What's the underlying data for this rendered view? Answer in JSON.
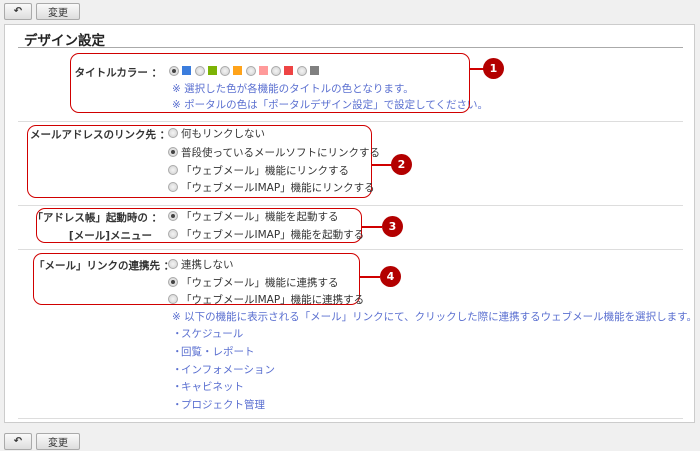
{
  "toolbar": {
    "back_icon": "back-arrow-icon",
    "change_label": "変更"
  },
  "page_title": "デザイン設定",
  "title_color": {
    "label": "タイトルカラー ：",
    "swatches": [
      "#3b7ddd",
      "#7cb305",
      "#ffa31a",
      "#ff9a9a",
      "#ee4444",
      "#808080"
    ],
    "selected": 0,
    "notes": [
      "※ 選択した色が各機能のタイトルの色となります。",
      "※ ポータルの色は「ポータルデザイン設定」で設定してください。"
    ]
  },
  "mail_link": {
    "label": "メールアドレスのリンク先 ：",
    "options": [
      "何もリンクしない",
      "普段使っているメールソフトにリンクする",
      "「ウェブメール」機能にリンクする",
      "「ウェブメールIMAP」機能にリンクする"
    ],
    "selected": 1
  },
  "address_book": {
    "label_line1": "「アドレス帳」起動時の ：",
    "label_line2": "[メール]メニュー",
    "options": [
      "「ウェブメール」機能を起動する",
      "「ウェブメールIMAP」機能を起動する"
    ],
    "selected": 0
  },
  "mail_link_target": {
    "label": "「メール」リンクの連携先 ：",
    "options": [
      "連携しない",
      "「ウェブメール」機能に連携する",
      "「ウェブメールIMAP」機能に連携する"
    ],
    "selected": 1,
    "note": "※ 以下の機能に表示される「メール」リンクにて、クリックした際に連携するウェブメール機能を選択します。",
    "features": [
      "スケジュール",
      "回覧・レポート",
      "インフォメーション",
      "キャビネット",
      "プロジェクト管理"
    ],
    "bullet": "・"
  },
  "markers": [
    "1",
    "2",
    "3",
    "4"
  ],
  "accent": "#d00000"
}
